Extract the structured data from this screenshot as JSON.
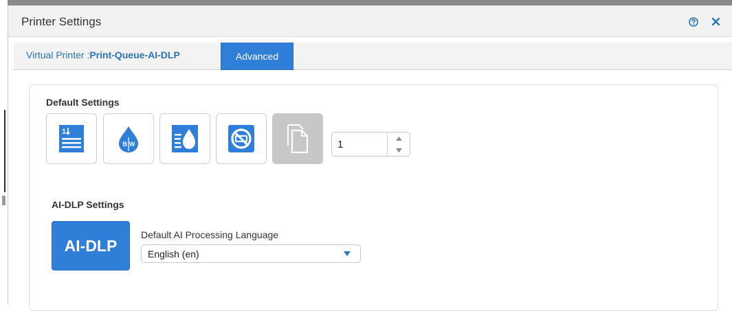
{
  "dialog": {
    "title": "Printer Settings"
  },
  "tabs": {
    "printer_prefix": "Virtual Printer :",
    "printer_name": "Print-Queue-AI-DLP",
    "advanced_label": "Advanced"
  },
  "default_settings": {
    "heading": "Default Settings",
    "options": [
      {
        "icon": "sort-order-icon",
        "enabled": true
      },
      {
        "icon": "black-white-drop-icon",
        "enabled": true
      },
      {
        "icon": "toner-save-icon",
        "enabled": true
      },
      {
        "icon": "no-staple-icon",
        "enabled": true
      },
      {
        "icon": "copies-icon",
        "enabled": false
      }
    ],
    "copies_value": "1"
  },
  "aidlp_settings": {
    "heading": "AI-DLP Settings",
    "badge": "AI-DLP",
    "language_label": "Default AI Processing Language",
    "language_value": "English (en)"
  },
  "colors": {
    "accent": "#2f7ed8",
    "link": "#2a73b5",
    "disabled": "#c7c7c7"
  }
}
